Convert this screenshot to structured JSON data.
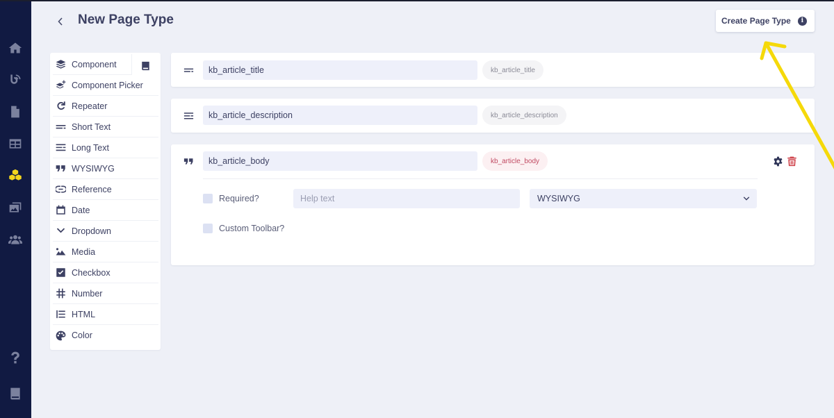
{
  "sidebar": {
    "items": [
      {
        "icon": "home-icon",
        "active": false
      },
      {
        "icon": "blog-feed-icon",
        "active": false
      },
      {
        "icon": "page-icon",
        "active": false
      },
      {
        "icon": "table-grid-icon",
        "active": false
      },
      {
        "icon": "components-cubes-icon",
        "active": true
      },
      {
        "icon": "media-library-icon",
        "active": false
      },
      {
        "icon": "users-icon",
        "active": false
      },
      {
        "icon": "help-icon",
        "active": false
      },
      {
        "icon": "docs-book-icon",
        "active": false
      }
    ],
    "accent": "#f3d51d"
  },
  "header": {
    "back_icon": "chevron-left-icon",
    "title": "New Page Type",
    "create_button": "Create Page Type",
    "info_glyph": "i"
  },
  "palette": {
    "items": [
      {
        "label": "Component",
        "icon": "layers-icon"
      },
      {
        "label": "Component Picker",
        "icon": "layers-plus-icon"
      },
      {
        "label": "Repeater",
        "icon": "redo-icon"
      },
      {
        "label": "Short Text",
        "icon": "short-text-icon"
      },
      {
        "label": "Long Text",
        "icon": "long-text-icon"
      },
      {
        "label": "WYSIWYG",
        "icon": "quote-icon"
      },
      {
        "label": "Reference",
        "icon": "link-icon"
      },
      {
        "label": "Date",
        "icon": "calendar-icon"
      },
      {
        "label": "Dropdown",
        "icon": "chevron-down-icon"
      },
      {
        "label": "Media",
        "icon": "image-icon"
      },
      {
        "label": "Checkbox",
        "icon": "checkbox-icon"
      },
      {
        "label": "Number",
        "icon": "hashtag-icon"
      },
      {
        "label": "HTML",
        "icon": "list-icon"
      },
      {
        "label": "Color",
        "icon": "palette-icon"
      }
    ],
    "docs_icon": "book-icon"
  },
  "fields": [
    {
      "type": "Short Text",
      "icon": "short-text-icon",
      "name": "kb_article_title",
      "slug": "kb_article_title"
    },
    {
      "type": "Long Text",
      "icon": "long-text-icon",
      "name": "kb_article_description",
      "slug": "kb_article_description"
    },
    {
      "type": "WYSIWYG",
      "icon": "quote-icon",
      "name": "kb_article_body",
      "slug": "kb_article_body",
      "expanded": {
        "required_label": "Required?",
        "required_checked": false,
        "help_text_value": "",
        "help_text_placeholder": "Help text",
        "editor_select": "WYSIWYG",
        "custom_toolbar_label": "Custom Toolbar?",
        "custom_toolbar_checked": false
      }
    }
  ],
  "colors": {
    "sidebar_bg": "#111a42",
    "text_primary": "#3d4163",
    "danger": "#d0474f",
    "annotation_arrow": "#f5d90a"
  }
}
